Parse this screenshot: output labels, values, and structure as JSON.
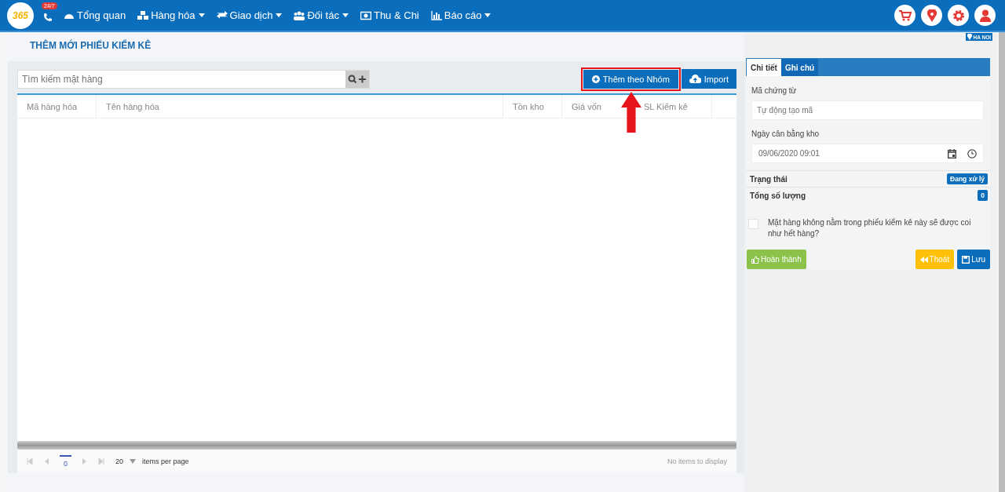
{
  "header": {
    "logo": "365",
    "hotline_badge": "24/7",
    "nav": [
      {
        "label": "Tổng quan",
        "dropdown": false
      },
      {
        "label": "Hàng hóa",
        "dropdown": true
      },
      {
        "label": "Giao dịch",
        "dropdown": true
      },
      {
        "label": "Đối tác",
        "dropdown": true
      },
      {
        "label": "Thu & Chi",
        "dropdown": false
      },
      {
        "label": "Báo cáo",
        "dropdown": true
      }
    ],
    "location": "HA NOI"
  },
  "page_title": "THÊM MỚI PHIẾU KIỂM KÊ",
  "search": {
    "placeholder": "Tìm kiếm mặt hàng"
  },
  "actions": [
    {
      "label": "Thêm theo Nhóm",
      "highlighted": true
    },
    {
      "label": "Import",
      "highlighted": false
    }
  ],
  "table": {
    "columns": [
      "Mã hàng hóa",
      "Tên hàng hóa",
      "Tồn kho",
      "Giá vốn",
      "SL Kiểm kê"
    ]
  },
  "pager": {
    "current_page": "0",
    "page_size": "20",
    "page_size_label": "items per page",
    "status": "No items to display"
  },
  "side": {
    "tabs": [
      {
        "label": "Chi tiết",
        "selected": true
      },
      {
        "label": "Ghi chú",
        "selected": false
      }
    ],
    "code_label": "Mã chứng từ",
    "code_placeholder": "Tự động tạo mã",
    "date_label": "Ngày cân bằng kho",
    "date_value": "09/06/2020 09:01",
    "summary": [
      {
        "label": "Trạng thái",
        "badge": "Đang xử lý"
      },
      {
        "label": "Tổng số lượng",
        "badge": "0"
      }
    ],
    "zero_stock_option": {
      "label": "Mặt hàng không nằm trong phiếu kiểm kê này sẽ được coi như hết hàng?",
      "checked": false
    },
    "buttons": [
      {
        "label": "Hoàn thành",
        "kind": "complete"
      },
      {
        "label": "Thoát",
        "kind": "exit"
      },
      {
        "label": "Lưu",
        "kind": "save"
      }
    ]
  }
}
